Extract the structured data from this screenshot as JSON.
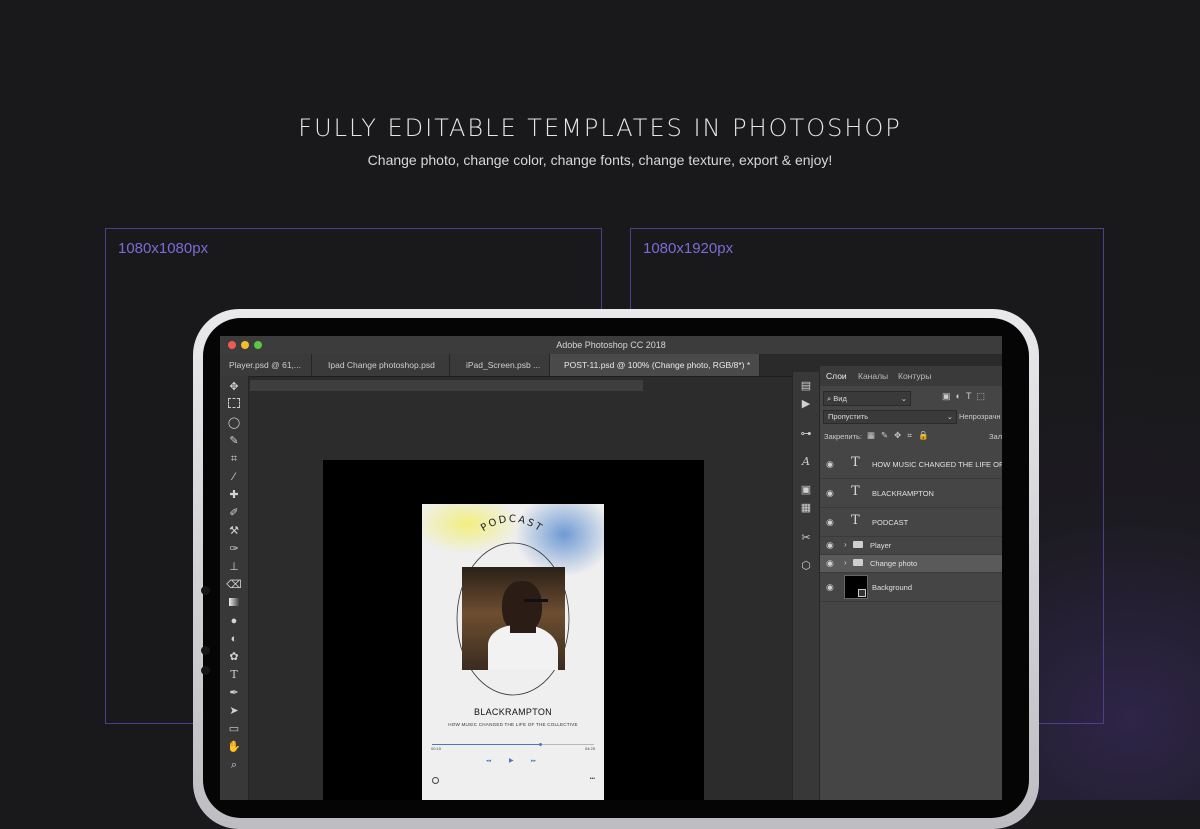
{
  "hero": {
    "title": "FULLY EDITABLE TEMPLATES IN PHOTOSHOP",
    "subtitle": "Change photo, change color, change fonts, change texture, export & enjoy!"
  },
  "frames": {
    "left_label": "1080x1080px",
    "right_label": "1080x1920px"
  },
  "colors": {
    "accent": "#7e6ad6",
    "frame_border": "#4d3f8c",
    "traffic_red": "#ee5a52",
    "traffic_yellow": "#f4bc2f",
    "traffic_green": "#5ec443"
  },
  "app": {
    "window_title": "Adobe Photoshop CC 2018",
    "tabs": [
      {
        "label": "Player.psd @ 61,..."
      },
      {
        "label": "Ipad Change photoshop.psd"
      },
      {
        "label": "iPad_Screen.psb ..."
      },
      {
        "label": "POST-11.psd @ 100% (Change photo, RGB/8*) *",
        "active": true
      }
    ],
    "tools": [
      "move-icon",
      "marquee-icon",
      "lasso-icon",
      "quick-select-icon",
      "crop-icon",
      "eyedropper-icon",
      "healing-brush-icon",
      "brush-icon",
      "clone-stamp-icon",
      "history-brush-icon",
      "stamp-icon",
      "eraser-icon",
      "gradient-icon",
      "blur-icon",
      "dodge-icon",
      "sponge-icon",
      "type-icon",
      "pen-icon",
      "path-select-icon",
      "rectangle-icon",
      "hand-icon",
      "zoom-icon"
    ],
    "panel": {
      "tabs": [
        "Слои",
        "Каналы",
        "Контуры"
      ],
      "filter_kind": "Вид",
      "blend_mode": "Пропустить",
      "opacity_label": "Непрозрачн",
      "lock_label": "Закрепить:",
      "fill_label": "Зал",
      "layers": [
        {
          "name": "HOW MUSIC CHANGED THE LIFE OF T",
          "kind": "text"
        },
        {
          "name": "BLACKRAMPTON",
          "kind": "text"
        },
        {
          "name": "PODCAST",
          "kind": "text"
        },
        {
          "name": "Player",
          "kind": "group"
        },
        {
          "name": "Change photo",
          "kind": "group",
          "selected": true
        },
        {
          "name": "Background",
          "kind": "image"
        }
      ]
    },
    "document": {
      "arc_title": "PODCAST",
      "artist": "BLACKRAMPTON",
      "tagline": "HOW MUSIC CHANGED THE LIFE OF THE COLLECTIVE",
      "time_elapsed": "00:15",
      "time_total": "04:25",
      "progress": 0.67,
      "controls": {
        "prev": "◂◂",
        "play": "▶",
        "next": "▸▸"
      },
      "menu": "•••"
    }
  }
}
